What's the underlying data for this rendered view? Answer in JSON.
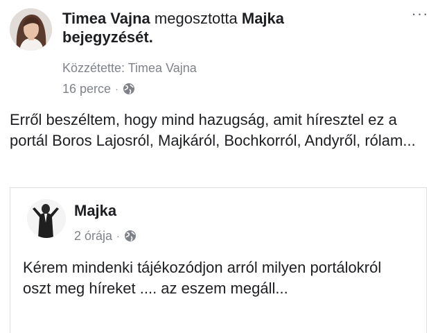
{
  "post": {
    "author": "Timea Vajna",
    "action": "megosztotta",
    "shared_from": "Majka",
    "shared_object": "bejegyzését",
    "published_by": "Közzétette: Timea Vajna",
    "timestamp": "16 perce",
    "separator": "·",
    "privacy_icon": "globe-icon",
    "more_label": "···",
    "text": "Erről beszéltem, hogy mind hazugság, amit híresztel ez a portál Boros Lajosról, Majkáról, Bochkorról, Andyről, rólam..."
  },
  "shared_post": {
    "author": "Majka",
    "timestamp": "2 órája",
    "separator": "·",
    "privacy_icon": "globe-icon",
    "text": "Kérem mindenki tájékozódjon arról milyen portálokról oszt meg híreket .... az eszem megáll..."
  }
}
